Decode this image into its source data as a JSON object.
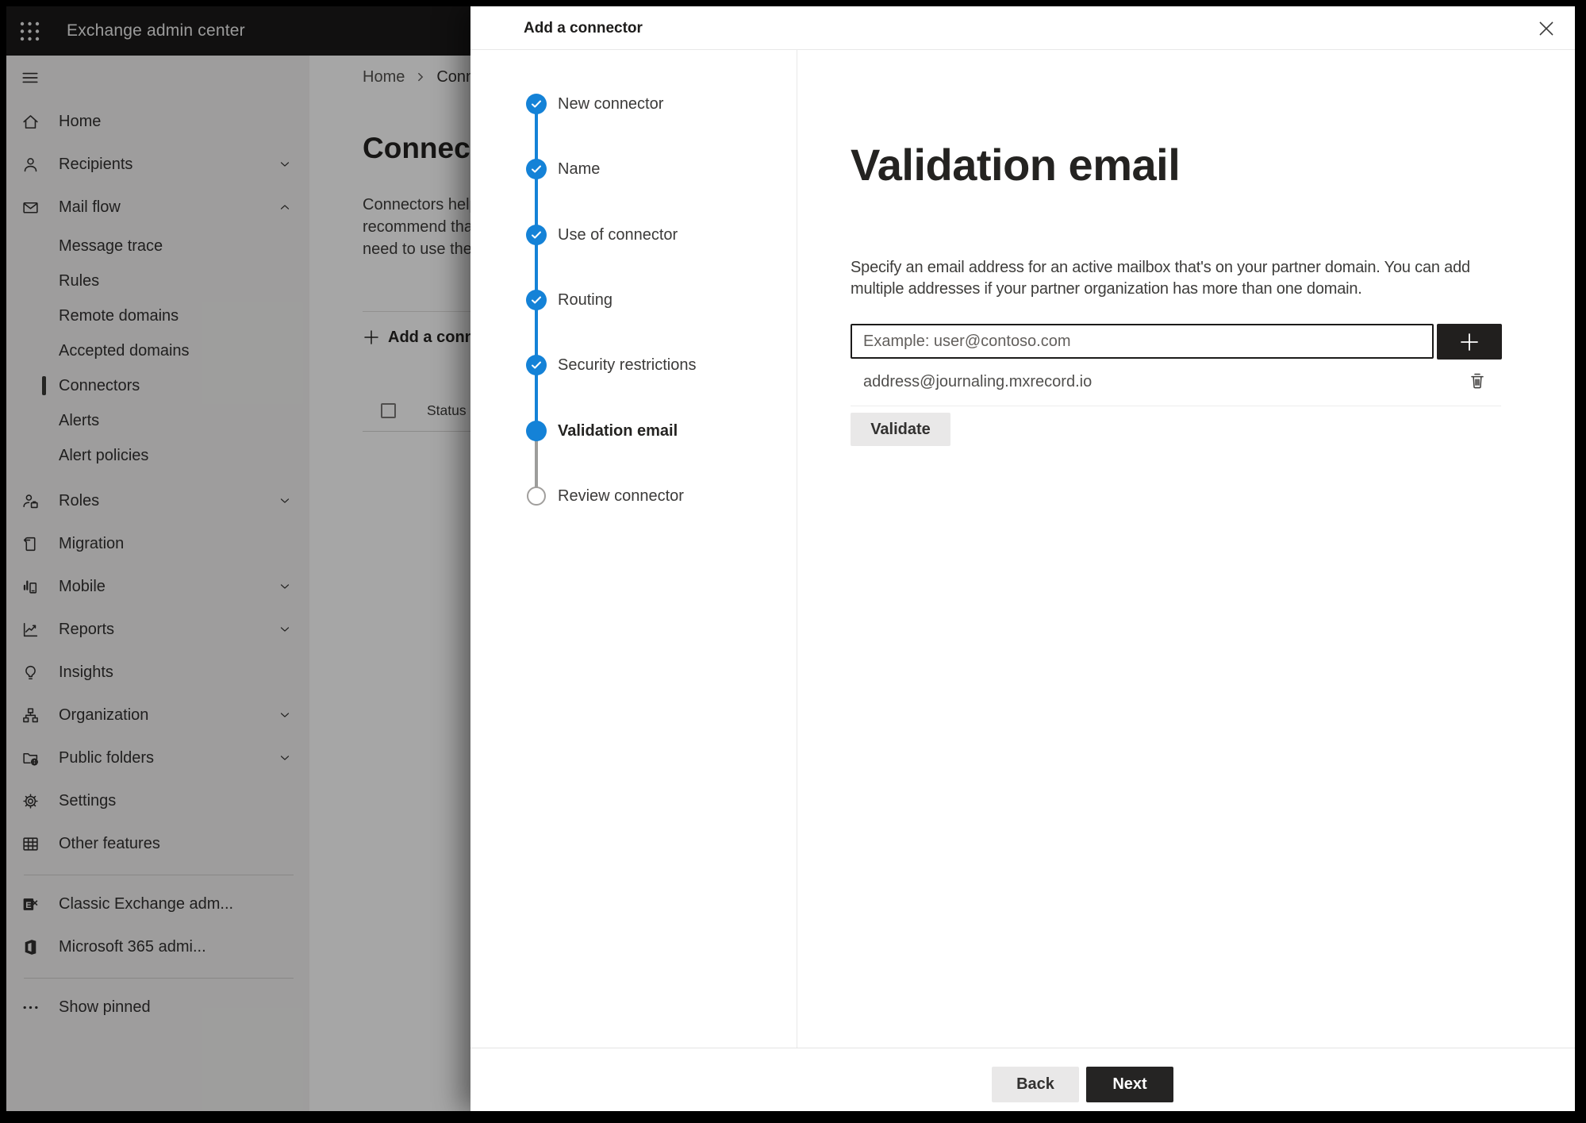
{
  "app": {
    "title": "Exchange admin center"
  },
  "colors": {
    "accent_blue": "#1482d7",
    "primary_button_bg": "#252423",
    "topbar_bg": "#1b1a19"
  },
  "sidebar": {
    "items": [
      {
        "label": "Home"
      },
      {
        "label": "Recipients"
      },
      {
        "label": "Mail flow"
      },
      {
        "label": "Message trace"
      },
      {
        "label": "Rules"
      },
      {
        "label": "Remote domains"
      },
      {
        "label": "Accepted domains"
      },
      {
        "label": "Connectors"
      },
      {
        "label": "Alerts"
      },
      {
        "label": "Alert policies"
      },
      {
        "label": "Roles"
      },
      {
        "label": "Migration"
      },
      {
        "label": "Mobile"
      },
      {
        "label": "Reports"
      },
      {
        "label": "Insights"
      },
      {
        "label": "Organization"
      },
      {
        "label": "Public folders"
      },
      {
        "label": "Settings"
      },
      {
        "label": "Other features"
      },
      {
        "label": "Classic Exchange adm..."
      },
      {
        "label": "Microsoft 365 admi..."
      },
      {
        "label": "Show pinned"
      }
    ]
  },
  "background": {
    "breadcrumb": {
      "home": "Home",
      "current": "Conne"
    },
    "page_title": "Connect",
    "description_lines": [
      "Connectors help",
      "recommend that",
      "need to use them"
    ],
    "add_button_label": "Add a conn",
    "table": {
      "status_header": "Status"
    }
  },
  "dialog": {
    "title": "Add a connector",
    "steps": [
      {
        "label": "New connector",
        "state": "completed"
      },
      {
        "label": "Name",
        "state": "completed"
      },
      {
        "label": "Use of connector",
        "state": "completed"
      },
      {
        "label": "Routing",
        "state": "completed"
      },
      {
        "label": "Security restrictions",
        "state": "completed"
      },
      {
        "label": "Validation email",
        "state": "current"
      },
      {
        "label": "Review connector",
        "state": "upcoming"
      }
    ],
    "main": {
      "heading": "Validation email",
      "description_lines": [
        "Specify an email address for an active mailbox that's on your partner domain. You can add",
        "multiple addresses if your partner organization has more than one domain."
      ],
      "input_placeholder": "Example: user@contoso.com",
      "address": "address@journaling.mxrecord.io",
      "validate_label": "Validate"
    },
    "footer": {
      "back_label": "Back",
      "next_label": "Next"
    }
  }
}
